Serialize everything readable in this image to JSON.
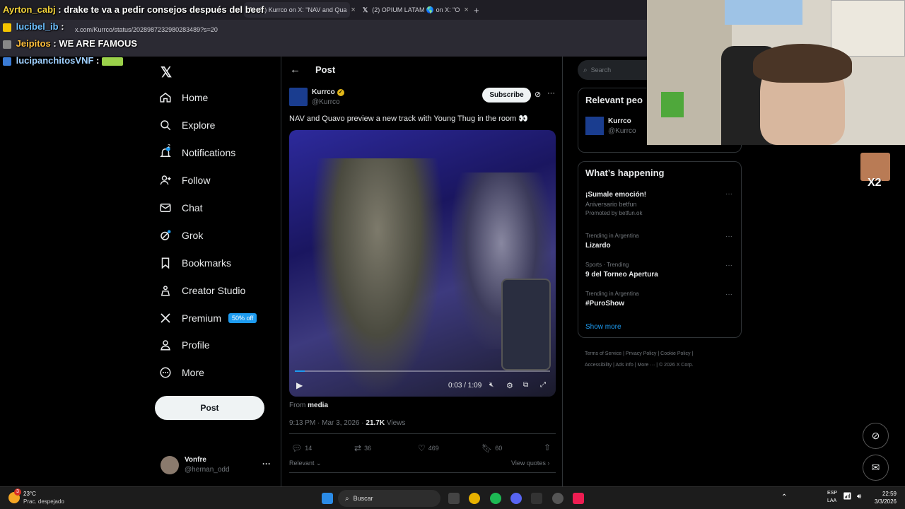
{
  "browser": {
    "tabs": [
      {
        "label": "(2) Kurrco on X: \"NAV and Qua"
      },
      {
        "label": "(2) OPIUM LATAM 🌎 on X: \"O"
      }
    ],
    "address": "x.com/Kurrco/status/2028987232980283489?s=20"
  },
  "chat_overlay": [
    {
      "user": "Ayrton_cabj",
      "message": "drake te va a pedir consejos después del beef"
    },
    {
      "user": "lucibel_ib",
      "message": ":"
    },
    {
      "user": "Jeipitos",
      "message": "WE ARE FAMOUS"
    },
    {
      "user": "lucipanchitosVNF",
      "message": ":"
    }
  ],
  "nav": {
    "items": [
      {
        "label": "Home",
        "icon": "home-icon"
      },
      {
        "label": "Explore",
        "icon": "search-icon"
      },
      {
        "label": "Notifications",
        "icon": "bell-icon",
        "badge": "2"
      },
      {
        "label": "Follow",
        "icon": "add-person-icon"
      },
      {
        "label": "Chat",
        "icon": "mail-icon"
      },
      {
        "label": "Grok",
        "icon": "grok-icon"
      },
      {
        "label": "Bookmarks",
        "icon": "bookmark-icon"
      },
      {
        "label": "Creator Studio",
        "icon": "creator-icon"
      },
      {
        "label": "Premium",
        "icon": "x-icon",
        "tag": "50% off"
      },
      {
        "label": "Profile",
        "icon": "person-icon"
      },
      {
        "label": "More",
        "icon": "more-circle-icon"
      }
    ],
    "post_label": "Post",
    "account": {
      "name": "Vonfre",
      "handle": "@hernan_odd"
    }
  },
  "post": {
    "header_title": "Post",
    "author": {
      "name": "Kurrco",
      "handle": "@Kurrco"
    },
    "subscribe_label": "Subscribe",
    "text": "NAV and Quavo preview a new track with Young Thug in the room 👀",
    "video": {
      "time": "0:03 / 1:09",
      "progress": 0.04
    },
    "from_label": "From",
    "from_source": "media",
    "timestamp": "9:13 PM · Mar 3, 2026 ·",
    "views_count": "21.7K",
    "views_label": "Views",
    "actions": {
      "replies": "14",
      "reposts": "36",
      "likes": "469",
      "bookmarks": "60"
    },
    "relevant_label": "Relevant",
    "view_quotes_label": "View quotes"
  },
  "right": {
    "search_placeholder": "Search",
    "relevant_people": {
      "title": "Relevant peo",
      "name": "Kurrco",
      "handle": "@Kurrco"
    },
    "whats_happening": {
      "title": "What’s happening",
      "items": [
        {
          "meta": "",
          "title": "¡Sumale emoción!",
          "sub": "Aniversario betfun",
          "promo": "Promoted by betfun.ok"
        },
        {
          "meta": "Trending in Argentina",
          "title": "Lizardo"
        },
        {
          "meta": "Sports · Trending",
          "title": "9 del Torneo Apertura"
        },
        {
          "meta": "Trending in Argentina",
          "title": "#PuroShow"
        }
      ],
      "show_more": "Show more"
    },
    "footer": {
      "line1": [
        "Terms of Service",
        "Privacy Policy",
        "Cookie Policy"
      ],
      "line2": [
        "Accessibility",
        "Ads info",
        "More ···",
        "© 2026 X Corp."
      ]
    }
  },
  "overlay_badge": "X2",
  "taskbar": {
    "weather_temp": "23°C",
    "weather_desc": "Prac. despejado",
    "search_label": "Buscar",
    "lang_top": "ESP",
    "lang_bottom": "LAA",
    "time": "22:59",
    "date": "3/3/2026",
    "weather_badge": "3"
  },
  "colors": {
    "accent": "#1d9bf0",
    "verified": "#e2b719",
    "background": "#000000"
  }
}
